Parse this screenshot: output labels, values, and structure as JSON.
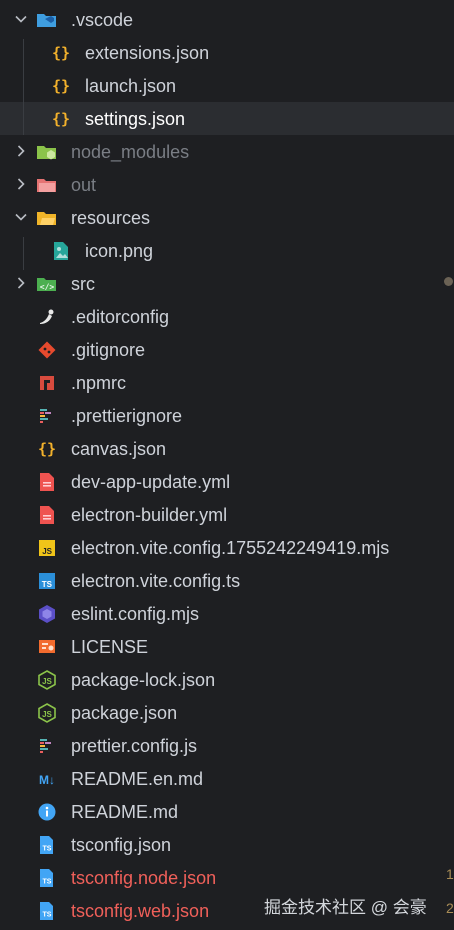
{
  "tree": [
    {
      "type": "folder",
      "state": "open",
      "indent": 0,
      "icon": "vscode-folder-icon",
      "label": ".vscode",
      "color": "#cfd3da"
    },
    {
      "type": "file",
      "indent": 1,
      "icon": "json-braces-icon",
      "label": "extensions.json",
      "color": "#cfd3da"
    },
    {
      "type": "file",
      "indent": 1,
      "icon": "json-braces-icon",
      "label": "launch.json",
      "color": "#cfd3da"
    },
    {
      "type": "file",
      "indent": 1,
      "icon": "json-braces-icon",
      "label": "settings.json",
      "color": "#ffffff",
      "selected": true
    },
    {
      "type": "folder",
      "state": "closed",
      "indent": 0,
      "icon": "node-folder-icon",
      "label": "node_modules",
      "color": "#7a7e85"
    },
    {
      "type": "folder",
      "state": "closed",
      "indent": 0,
      "icon": "out-folder-icon",
      "label": "out",
      "color": "#7a7e85"
    },
    {
      "type": "folder",
      "state": "open",
      "indent": 0,
      "icon": "resources-folder-icon",
      "label": "resources",
      "color": "#cfd3da"
    },
    {
      "type": "file",
      "indent": 1,
      "icon": "image-file-icon",
      "label": "icon.png",
      "color": "#cfd3da"
    },
    {
      "type": "folder",
      "state": "closed",
      "indent": 0,
      "icon": "src-folder-icon",
      "label": "src",
      "color": "#cfd3da"
    },
    {
      "type": "file",
      "indent": 0,
      "icon": "editorconfig-icon",
      "label": ".editorconfig",
      "color": "#cfd3da"
    },
    {
      "type": "file",
      "indent": 0,
      "icon": "git-icon",
      "label": ".gitignore",
      "color": "#cfd3da"
    },
    {
      "type": "file",
      "indent": 0,
      "icon": "npm-icon",
      "label": ".npmrc",
      "color": "#cfd3da"
    },
    {
      "type": "file",
      "indent": 0,
      "icon": "prettier-icon",
      "label": ".prettierignore",
      "color": "#cfd3da"
    },
    {
      "type": "file",
      "indent": 0,
      "icon": "json-braces-icon",
      "label": "canvas.json",
      "color": "#cfd3da"
    },
    {
      "type": "file",
      "indent": 0,
      "icon": "yaml-file-icon",
      "label": "dev-app-update.yml",
      "color": "#cfd3da"
    },
    {
      "type": "file",
      "indent": 0,
      "icon": "yaml-file-icon",
      "label": "electron-builder.yml",
      "color": "#cfd3da"
    },
    {
      "type": "file",
      "indent": 0,
      "icon": "javascript-icon",
      "label": "electron.vite.config.1755242249419.mjs",
      "color": "#cfd3da"
    },
    {
      "type": "file",
      "indent": 0,
      "icon": "typescript-icon",
      "label": "electron.vite.config.ts",
      "color": "#cfd3da"
    },
    {
      "type": "file",
      "indent": 0,
      "icon": "eslint-icon",
      "label": "eslint.config.mjs",
      "color": "#cfd3da"
    },
    {
      "type": "file",
      "indent": 0,
      "icon": "license-icon",
      "label": "LICENSE",
      "color": "#cfd3da"
    },
    {
      "type": "file",
      "indent": 0,
      "icon": "nodejs-icon",
      "label": "package-lock.json",
      "color": "#cfd3da"
    },
    {
      "type": "file",
      "indent": 0,
      "icon": "nodejs-icon",
      "label": "package.json",
      "color": "#cfd3da"
    },
    {
      "type": "file",
      "indent": 0,
      "icon": "prettier-icon",
      "label": "prettier.config.js",
      "color": "#cfd3da"
    },
    {
      "type": "file",
      "indent": 0,
      "icon": "markdown-icon",
      "label": "README.en.md",
      "color": "#cfd3da"
    },
    {
      "type": "file",
      "indent": 0,
      "icon": "info-icon",
      "label": "README.md",
      "color": "#cfd3da"
    },
    {
      "type": "file",
      "indent": 0,
      "icon": "tsconfig-icon",
      "label": "tsconfig.json",
      "color": "#cfd3da"
    },
    {
      "type": "file",
      "indent": 0,
      "icon": "tsconfig-icon",
      "label": "tsconfig.node.json",
      "color": "#f0605a"
    },
    {
      "type": "file",
      "indent": 0,
      "icon": "tsconfig-icon",
      "label": "tsconfig.web.json",
      "color": "#f0605a"
    }
  ],
  "watermark": "掘金技术社区 @ 会豪",
  "edge_marks": [
    "1",
    "2"
  ]
}
